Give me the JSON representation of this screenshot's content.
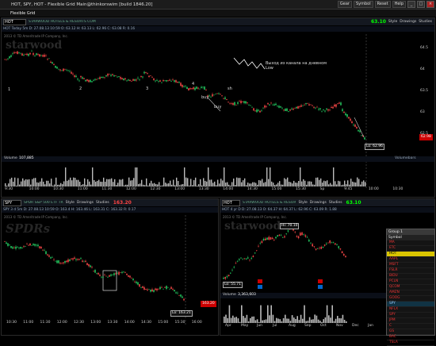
{
  "window": {
    "title": "HOT, SPY, HOT - Flexible Grid Main@thinkorswim [build 1846.20]",
    "buttons": [
      "Gear",
      "Symbol",
      "Reset",
      "Help"
    ]
  },
  "grid": {
    "name": "Flexible Grid"
  },
  "main_chart": {
    "symbol": "HOT",
    "description": "STARWOOD HOTELS & RESORTS COM",
    "price": "63.10",
    "quote_line": "HOT Today 5m   D: 27.08.13 10:59   O: 63.12   H: 63.13   L: 62.96   C: 63.08   R: 0.16",
    "copyright": "2013 © TD Ameritrade IP Company, Inc.",
    "watermark": "starwood",
    "annotation": "Выход из канала на дневном Low",
    "points": [
      "1",
      "2",
      "3",
      "4"
    ],
    "labels": {
      "buy1": "buy",
      "buy2": "buy",
      "sh": "sh",
      "low": "Lo: 62.96"
    },
    "y_ticks": [
      "64.5",
      "64",
      "63.5",
      "63",
      "62.5"
    ],
    "last_price_tag": "62.98",
    "volume_label": "Volume",
    "volume_value": "107,885",
    "volume_right": "Volumebars",
    "x_ticks": [
      "9:30",
      "10:00",
      "10:30",
      "11:00",
      "11:30",
      "12:00",
      "12:30",
      "13:00",
      "13:30",
      "14:00",
      "14:30",
      "15:00",
      "15:30",
      "Sp",
      "9:45",
      "10:00",
      "10:30"
    ]
  },
  "spy_chart": {
    "symbol": "SPY",
    "description": "SPDR S&P 500 ETF TR",
    "price": "163.20",
    "quote_line": "SPY 3 d 5m   D: 27.08.13 10:59   O: 163.4   H: 163.46   L: 163.31   C: 163.32   R: 0.17",
    "copyright": "2013 © TD Ameritrade IP Company, Inc.",
    "watermark": "SPDRs",
    "low_label": "Lo: 163.21",
    "last_price_tag": "163.20",
    "x_ticks": [
      "10:30",
      "11:00",
      "11:30",
      "12:00",
      "12:30",
      "13:00",
      "13:30",
      "14:00",
      "14:30",
      "15:00",
      "15:30",
      "16:00"
    ]
  },
  "hot_daily": {
    "symbol": "HOT",
    "description": "STARWOOD HOTELS & RESOR",
    "price": "63.10",
    "quote_line": "HOT 4 yr D   D: 27.08.13   O: 64.37   H: 64.37   L: 62.96   C: 63.09   R: 1.88",
    "copyright": "2013 © TD Ameritrade IP Company, Inc.",
    "watermark": "starwood",
    "hi_label": "Hi: 70.10",
    "lo_label": "Lo: 55.71",
    "volume_label": "Volume",
    "volume_value": "3,363,603",
    "x_ticks": [
      "Apr",
      "May",
      "Jun",
      "Jul",
      "Aug",
      "Sep",
      "Oct",
      "Nov",
      "Dec",
      "Jan"
    ]
  },
  "watchlist": {
    "title": "Group 1",
    "header": "Symbol",
    "rows": [
      "MA",
      "ETC",
      "HOT",
      "AAPL",
      "MSFT",
      "FSLR",
      "BIDU",
      "PCLN",
      "QCOM",
      "AMZN",
      "GOOG",
      "SPY",
      "NFLX",
      "SPY",
      "JPM",
      "C",
      "GS",
      "BAC",
      "TSLA"
    ],
    "highlighted": "HOT"
  },
  "colors": {
    "up": "#22c55e",
    "down": "#ef4444",
    "accent": "#d9c400"
  }
}
